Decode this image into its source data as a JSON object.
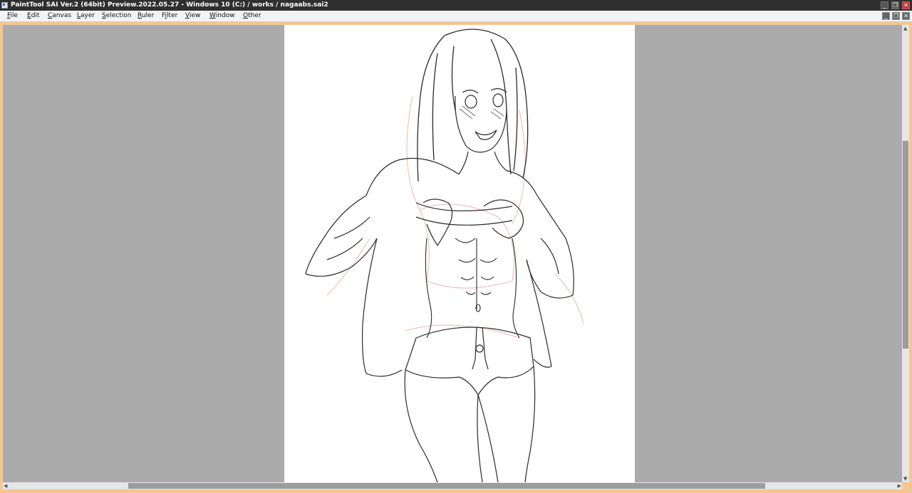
{
  "window": {
    "title": "PaintTool SAI Ver.2 (64bit) Preview.2022.05.27 - Windows 10 (C:) / works / nagaabs.sai2",
    "buttons": {
      "minimize": "_",
      "restore": "❐",
      "close": "✕"
    }
  },
  "menu": {
    "items": [
      {
        "pre": "",
        "key": "F",
        "post": "ile"
      },
      {
        "pre": "",
        "key": "E",
        "post": "dit"
      },
      {
        "pre": "",
        "key": "C",
        "post": "anvas"
      },
      {
        "pre": "",
        "key": "L",
        "post": "ayer"
      },
      {
        "pre": "",
        "key": "S",
        "post": "election"
      },
      {
        "pre": "",
        "key": "R",
        "post": "uler"
      },
      {
        "pre": "F",
        "key": "i",
        "post": "lter"
      },
      {
        "pre": "",
        "key": "V",
        "post": "iew"
      },
      {
        "pre": "",
        "key": "W",
        "post": "indow"
      },
      {
        "pre": "",
        "key": "O",
        "post": "ther"
      }
    ],
    "mdi_buttons": {
      "minimize": "_",
      "restore": "❐",
      "close": "✕"
    }
  },
  "colors": {
    "titlebar": "#2f2f2f",
    "menubar": "#f3f3f3",
    "workspace_border": "#f4c692",
    "canvas_background": "#ababab",
    "paper": "#ffffff",
    "lineart": "#2a2a2a",
    "sketch": "#e8a6a6"
  },
  "canvas": {
    "artwork": "anime-style line art sketch of a girl lifting her shirt",
    "icons": [
      "paintbrush-canvas-icon"
    ]
  },
  "scrollbars": {
    "vertical_position": 0.36,
    "horizontal_position": 0.5
  }
}
